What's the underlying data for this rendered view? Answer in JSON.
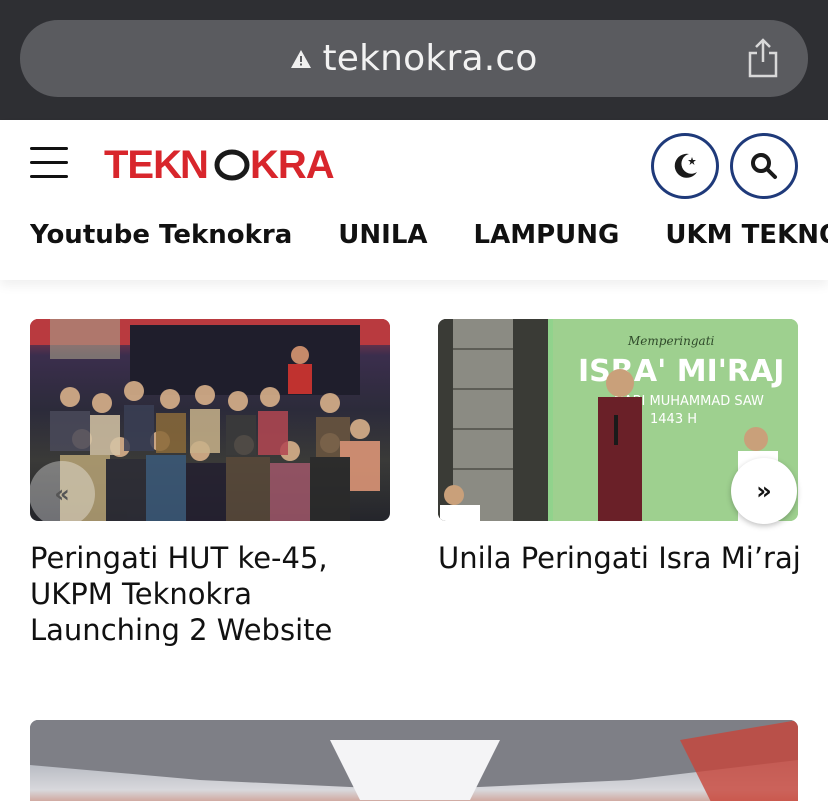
{
  "browser": {
    "url": "teknokra.co"
  },
  "header": {
    "logo_text": "TEKNOKRA",
    "nav": [
      {
        "label": "Youtube Teknokra"
      },
      {
        "label": "UNILA"
      },
      {
        "label": "LAMPUNG"
      },
      {
        "label": "UKM TEKNOKRA"
      }
    ]
  },
  "articles": [
    {
      "title": "Peringati HUT ke-45, UKPM Teknokra Launching 2 Website"
    },
    {
      "title": "Unila Peringati Isra Mi’raj"
    }
  ],
  "carousel": {
    "prev_label": "«",
    "next_label": "»"
  },
  "colors": {
    "brand_red": "#d8262c",
    "accent_blue": "#1f3a7a"
  }
}
